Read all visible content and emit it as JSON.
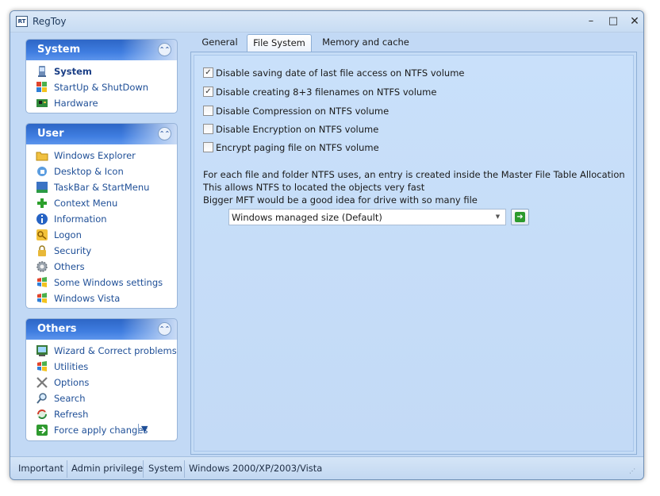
{
  "window": {
    "title": "RegToy",
    "app_icon": "RT"
  },
  "sidebar": {
    "panels": [
      {
        "title": "System",
        "items": [
          {
            "label": "System",
            "icon": "computer-icon",
            "active": true
          },
          {
            "label": "StartUp & ShutDown",
            "icon": "windows-flag-icon"
          },
          {
            "label": "Hardware",
            "icon": "circuit-board-icon"
          }
        ]
      },
      {
        "title": "User",
        "items": [
          {
            "label": "Windows Explorer",
            "icon": "folder-icon"
          },
          {
            "label": "Desktop & Icon",
            "icon": "desktop-icon"
          },
          {
            "label": "TaskBar & StartMenu",
            "icon": "taskbar-icon"
          },
          {
            "label": "Context Menu",
            "icon": "plus-icon"
          },
          {
            "label": "Information",
            "icon": "info-icon"
          },
          {
            "label": "Logon",
            "icon": "key-icon"
          },
          {
            "label": "Security",
            "icon": "lock-icon"
          },
          {
            "label": "Others",
            "icon": "gear-icon"
          },
          {
            "label": "Some Windows settings",
            "icon": "windows-logo-icon"
          },
          {
            "label": "Windows Vista",
            "icon": "windows-logo-icon"
          }
        ]
      },
      {
        "title": "Others",
        "items": [
          {
            "label": "Wizard & Correct problems",
            "icon": "wizard-icon"
          },
          {
            "label": "Utilities",
            "icon": "windows-logo-icon"
          },
          {
            "label": "Options",
            "icon": "tools-icon"
          },
          {
            "label": "Search",
            "icon": "magnifier-icon"
          },
          {
            "label": "Refresh",
            "icon": "refresh-icon"
          },
          {
            "label": "Force apply changes",
            "icon": "arrow-right-icon",
            "dropdown": "▼"
          }
        ]
      }
    ]
  },
  "tabs": [
    {
      "label": "General",
      "active": false
    },
    {
      "label": "File System",
      "active": true
    },
    {
      "label": "Memory and cache",
      "active": false
    }
  ],
  "file_system": {
    "options": [
      {
        "label": "Disable saving date of last file access on NTFS volume",
        "checked": true
      },
      {
        "label": "Disable creating 8+3 filenames on NTFS volume",
        "checked": true
      },
      {
        "label": "Disable Compression on NTFS volume",
        "checked": false
      },
      {
        "label": "Disable Encryption on NTFS volume",
        "checked": false
      },
      {
        "label": "Encrypt paging file on NTFS volume",
        "checked": false
      }
    ],
    "info_lines": [
      "For each file and folder NTFS uses, an entry is created inside the Master File Table Allocation",
      "This allows NTFS to located the objects very fast",
      "Bigger MFT would be a good idea for drive with so many file"
    ],
    "mft_select": {
      "value": "Windows managed size (Default)"
    }
  },
  "statusbar": {
    "items": [
      "Important",
      "Admin privilege",
      "System",
      "Windows 2000/XP/2003/Vista"
    ]
  }
}
